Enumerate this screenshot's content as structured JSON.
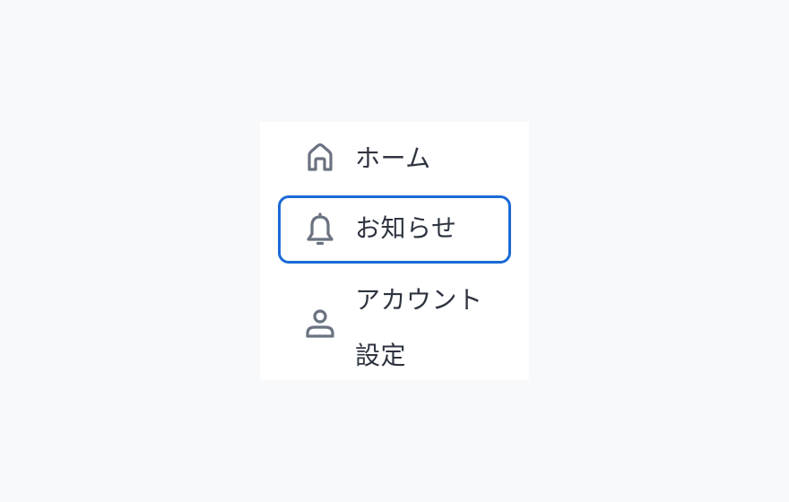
{
  "menu": {
    "items": [
      {
        "label": "ホーム",
        "icon": "home-icon",
        "active": false
      },
      {
        "label": "お知らせ",
        "icon": "bell-icon",
        "active": true
      },
      {
        "label": "アカウント設定",
        "icon": "user-icon",
        "active": false
      }
    ]
  },
  "colors": {
    "background": "#f8f9fb",
    "menu_background": "#ffffff",
    "active_border": "#1a6ad6",
    "icon": "#6b7280",
    "text": "#2e3440"
  }
}
